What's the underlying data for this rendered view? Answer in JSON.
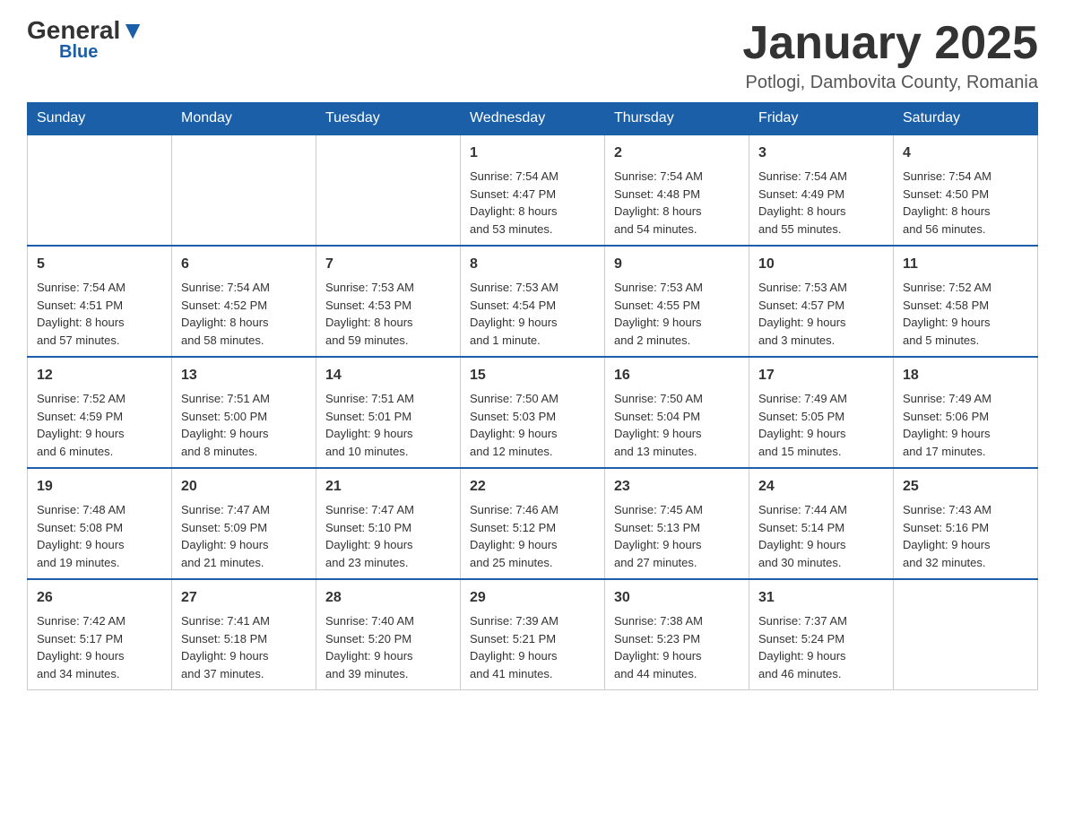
{
  "logo": {
    "general": "General",
    "triangle": "",
    "blue": "Blue"
  },
  "title": "January 2025",
  "subtitle": "Potlogi, Dambovita County, Romania",
  "weekdays": [
    "Sunday",
    "Monday",
    "Tuesday",
    "Wednesday",
    "Thursday",
    "Friday",
    "Saturday"
  ],
  "weeks": [
    [
      {
        "day": "",
        "info": ""
      },
      {
        "day": "",
        "info": ""
      },
      {
        "day": "",
        "info": ""
      },
      {
        "day": "1",
        "info": "Sunrise: 7:54 AM\nSunset: 4:47 PM\nDaylight: 8 hours\nand 53 minutes."
      },
      {
        "day": "2",
        "info": "Sunrise: 7:54 AM\nSunset: 4:48 PM\nDaylight: 8 hours\nand 54 minutes."
      },
      {
        "day": "3",
        "info": "Sunrise: 7:54 AM\nSunset: 4:49 PM\nDaylight: 8 hours\nand 55 minutes."
      },
      {
        "day": "4",
        "info": "Sunrise: 7:54 AM\nSunset: 4:50 PM\nDaylight: 8 hours\nand 56 minutes."
      }
    ],
    [
      {
        "day": "5",
        "info": "Sunrise: 7:54 AM\nSunset: 4:51 PM\nDaylight: 8 hours\nand 57 minutes."
      },
      {
        "day": "6",
        "info": "Sunrise: 7:54 AM\nSunset: 4:52 PM\nDaylight: 8 hours\nand 58 minutes."
      },
      {
        "day": "7",
        "info": "Sunrise: 7:53 AM\nSunset: 4:53 PM\nDaylight: 8 hours\nand 59 minutes."
      },
      {
        "day": "8",
        "info": "Sunrise: 7:53 AM\nSunset: 4:54 PM\nDaylight: 9 hours\nand 1 minute."
      },
      {
        "day": "9",
        "info": "Sunrise: 7:53 AM\nSunset: 4:55 PM\nDaylight: 9 hours\nand 2 minutes."
      },
      {
        "day": "10",
        "info": "Sunrise: 7:53 AM\nSunset: 4:57 PM\nDaylight: 9 hours\nand 3 minutes."
      },
      {
        "day": "11",
        "info": "Sunrise: 7:52 AM\nSunset: 4:58 PM\nDaylight: 9 hours\nand 5 minutes."
      }
    ],
    [
      {
        "day": "12",
        "info": "Sunrise: 7:52 AM\nSunset: 4:59 PM\nDaylight: 9 hours\nand 6 minutes."
      },
      {
        "day": "13",
        "info": "Sunrise: 7:51 AM\nSunset: 5:00 PM\nDaylight: 9 hours\nand 8 minutes."
      },
      {
        "day": "14",
        "info": "Sunrise: 7:51 AM\nSunset: 5:01 PM\nDaylight: 9 hours\nand 10 minutes."
      },
      {
        "day": "15",
        "info": "Sunrise: 7:50 AM\nSunset: 5:03 PM\nDaylight: 9 hours\nand 12 minutes."
      },
      {
        "day": "16",
        "info": "Sunrise: 7:50 AM\nSunset: 5:04 PM\nDaylight: 9 hours\nand 13 minutes."
      },
      {
        "day": "17",
        "info": "Sunrise: 7:49 AM\nSunset: 5:05 PM\nDaylight: 9 hours\nand 15 minutes."
      },
      {
        "day": "18",
        "info": "Sunrise: 7:49 AM\nSunset: 5:06 PM\nDaylight: 9 hours\nand 17 minutes."
      }
    ],
    [
      {
        "day": "19",
        "info": "Sunrise: 7:48 AM\nSunset: 5:08 PM\nDaylight: 9 hours\nand 19 minutes."
      },
      {
        "day": "20",
        "info": "Sunrise: 7:47 AM\nSunset: 5:09 PM\nDaylight: 9 hours\nand 21 minutes."
      },
      {
        "day": "21",
        "info": "Sunrise: 7:47 AM\nSunset: 5:10 PM\nDaylight: 9 hours\nand 23 minutes."
      },
      {
        "day": "22",
        "info": "Sunrise: 7:46 AM\nSunset: 5:12 PM\nDaylight: 9 hours\nand 25 minutes."
      },
      {
        "day": "23",
        "info": "Sunrise: 7:45 AM\nSunset: 5:13 PM\nDaylight: 9 hours\nand 27 minutes."
      },
      {
        "day": "24",
        "info": "Sunrise: 7:44 AM\nSunset: 5:14 PM\nDaylight: 9 hours\nand 30 minutes."
      },
      {
        "day": "25",
        "info": "Sunrise: 7:43 AM\nSunset: 5:16 PM\nDaylight: 9 hours\nand 32 minutes."
      }
    ],
    [
      {
        "day": "26",
        "info": "Sunrise: 7:42 AM\nSunset: 5:17 PM\nDaylight: 9 hours\nand 34 minutes."
      },
      {
        "day": "27",
        "info": "Sunrise: 7:41 AM\nSunset: 5:18 PM\nDaylight: 9 hours\nand 37 minutes."
      },
      {
        "day": "28",
        "info": "Sunrise: 7:40 AM\nSunset: 5:20 PM\nDaylight: 9 hours\nand 39 minutes."
      },
      {
        "day": "29",
        "info": "Sunrise: 7:39 AM\nSunset: 5:21 PM\nDaylight: 9 hours\nand 41 minutes."
      },
      {
        "day": "30",
        "info": "Sunrise: 7:38 AM\nSunset: 5:23 PM\nDaylight: 9 hours\nand 44 minutes."
      },
      {
        "day": "31",
        "info": "Sunrise: 7:37 AM\nSunset: 5:24 PM\nDaylight: 9 hours\nand 46 minutes."
      },
      {
        "day": "",
        "info": ""
      }
    ]
  ]
}
